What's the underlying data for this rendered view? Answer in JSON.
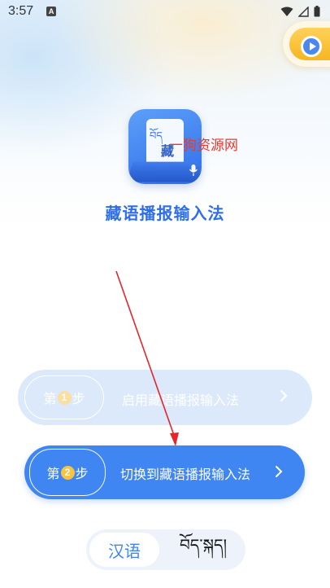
{
  "status_bar": {
    "time": "3:57",
    "notification_badge": "A",
    "icons": [
      "wifi-icon",
      "signal-icon",
      "battery-icon"
    ]
  },
  "floating_button": {
    "icon": "play-icon"
  },
  "app": {
    "icon_tibetan_text": "བོད",
    "icon_chinese_text": "藏",
    "title": "藏语播报输入法"
  },
  "watermark": "一狗资源网",
  "steps": [
    {
      "prefix": "第",
      "number": "1",
      "suffix": "步",
      "label": "启用藏语播报输入法",
      "state": "done"
    },
    {
      "prefix": "第",
      "number": "2",
      "suffix": "步",
      "label": "切换到藏语播报输入法",
      "state": "active"
    }
  ],
  "language_switch": {
    "options": [
      "汉语",
      "བོད་སྐད།"
    ],
    "selected": "汉语"
  },
  "colors": {
    "primary": "#3f86f2",
    "step_done_bg": "#dce9fb",
    "title": "#2f6ee9",
    "badge_number": "#f6c343",
    "annotation_arrow": "#e3262b"
  }
}
